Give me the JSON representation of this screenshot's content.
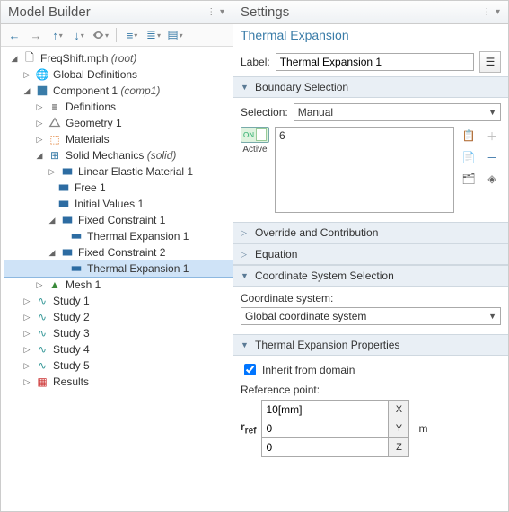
{
  "left": {
    "title": "Model Builder",
    "tree": {
      "root": "FreqShift.mph",
      "root_suffix": "(root)",
      "global_defs": "Global Definitions",
      "component": "Component 1",
      "component_suffix": "(comp1)",
      "definitions": "Definitions",
      "geometry": "Geometry 1",
      "materials": "Materials",
      "solid": "Solid Mechanics",
      "solid_suffix": "(solid)",
      "lem": "Linear Elastic Material 1",
      "free": "Free 1",
      "initvals": "Initial Values 1",
      "fc1": "Fixed Constraint 1",
      "te1": "Thermal Expansion 1",
      "fc2": "Fixed Constraint 2",
      "te2": "Thermal Expansion 1",
      "mesh": "Mesh 1",
      "study1": "Study 1",
      "study2": "Study 2",
      "study3": "Study 3",
      "study4": "Study 4",
      "study5": "Study 5",
      "results": "Results"
    }
  },
  "right": {
    "title": "Settings",
    "subtitle": "Thermal Expansion",
    "label_lbl": "Label:",
    "label_val": "Thermal Expansion 1",
    "sections": {
      "boundary": "Boundary Selection",
      "override": "Override and Contribution",
      "equation": "Equation",
      "coordsys": "Coordinate System Selection",
      "thermprops": "Thermal Expansion Properties"
    },
    "selection_lbl": "Selection:",
    "selection_val": "Manual",
    "active_lbl": "Active",
    "list_item": "6",
    "coord_lbl": "Coordinate system:",
    "coord_val": "Global coordinate system",
    "inherit": "Inherit from domain",
    "refpoint_lbl": "Reference point:",
    "rref": "rref",
    "xval": "10[mm]",
    "yval": "0",
    "zval": "0",
    "ax_x": "X",
    "ax_y": "Y",
    "ax_z": "Z",
    "unit": "m"
  }
}
